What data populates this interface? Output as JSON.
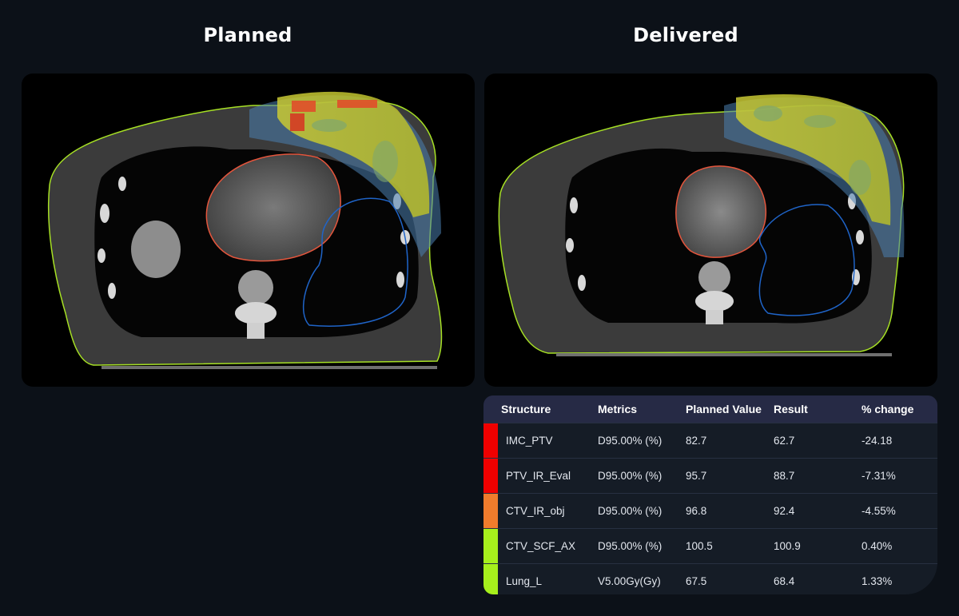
{
  "headings": {
    "planned": "Planned",
    "delivered": "Delivered"
  },
  "colors": {
    "background": "#0c1118",
    "ptv_red": "#f00000",
    "ctv_orange": "#f07c2c",
    "ctv_green": "#a6ef1c",
    "body_contour": "#a6e024",
    "heart_contour": "#e4553c",
    "lung_contour": "#1f64c8"
  },
  "table": {
    "headers": [
      "Structure",
      "Metrics",
      "Planned Value",
      "Result",
      "% change"
    ],
    "rows": [
      {
        "structure": "IMC_PTV",
        "metric": "D95.00% (%)",
        "planned": "82.7",
        "result": "62.7",
        "change": "-24.18",
        "color": "#f00000"
      },
      {
        "structure": "PTV_IR_Eval",
        "metric": "D95.00% (%)",
        "planned": "95.7",
        "result": "88.7",
        "change": "-7.31%",
        "color": "#f00000"
      },
      {
        "structure": "CTV_IR_obj",
        "metric": "D95.00% (%)",
        "planned": "96.8",
        "result": "92.4",
        "change": "-4.55%",
        "color": "#f07c2c"
      },
      {
        "structure": "CTV_SCF_AX",
        "metric": "D95.00% (%)",
        "planned": "100.5",
        "result": "100.9",
        "change": "0.40%",
        "color": "#a6ef1c"
      },
      {
        "structure": "Lung_L",
        "metric": "V5.00Gy(Gy)",
        "planned": "67.5",
        "result": "68.4",
        "change": "1.33%",
        "color": "#a6ef1c"
      }
    ]
  }
}
